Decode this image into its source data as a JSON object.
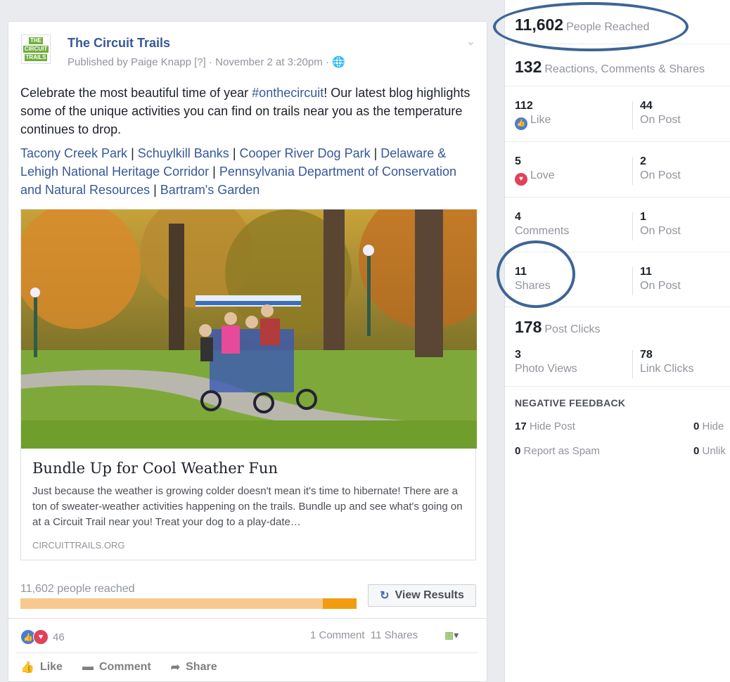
{
  "post": {
    "logo_lines": [
      "THE",
      "CIRCUIT",
      "TRAILS"
    ],
    "page_name": "The Circuit Trails",
    "byline": "Published by Paige Knapp [?] · November 2 at 3:20pm · ",
    "text_before": "Celebrate the most beautiful time of year ",
    "hashtag": "#onthecircuit",
    "text_after": "! Our latest blog highlights some of the unique activities you can find on trails near you as the temperature continues to drop.",
    "tags": [
      "Tacony Creek Park",
      "Schuylkill Banks",
      "Cooper River Dog Park",
      "Delaware & Lehigh National Heritage Corridor",
      "Pennsylvania Department of Conservation and Natural Resources",
      "Bartram's Garden"
    ],
    "link_card": {
      "title": "Bundle Up for Cool Weather Fun",
      "description": "Just because the weather is growing colder doesn't mean it's time to hibernate! There are a ton of sweater-weather activities happening on the trails. Bundle up and see what's going on at a Circuit Trail near you! Treat your dog to a play-date…",
      "domain": "CIRCUITTRAILS.ORG"
    },
    "reach_label": "11,602 people reached",
    "reach_paid_fraction": 0.1,
    "view_results_label": "View Results",
    "reaction_count": "46",
    "comments_label": "1 Comment",
    "shares_label": "11 Shares",
    "actions": {
      "like": "Like",
      "comment": "Comment",
      "share": "Share"
    }
  },
  "insights": {
    "people_reached": {
      "value": "11,602",
      "label": "People Reached"
    },
    "engagement": {
      "value": "132",
      "label": "Reactions, Comments & Shares"
    },
    "likes": {
      "value": "112",
      "label": "Like",
      "on_post": "44",
      "on_post_label": "On Post"
    },
    "love": {
      "value": "5",
      "label": "Love",
      "on_post": "2",
      "on_post_label": "On Post"
    },
    "comments": {
      "value": "4",
      "label": "Comments",
      "on_post": "1",
      "on_post_label": "On Post"
    },
    "shares": {
      "value": "11",
      "label": "Shares",
      "on_post": "11",
      "on_post_label": "On Post"
    },
    "post_clicks": {
      "value": "178",
      "label": "Post Clicks"
    },
    "photo_views": {
      "value": "3",
      "label": "Photo Views"
    },
    "link_clicks": {
      "value": "78",
      "label": "Link Clicks"
    },
    "negative_feedback": {
      "heading": "NEGATIVE FEEDBACK",
      "hide_post": {
        "value": "17",
        "label": "Hide Post"
      },
      "hide_all": {
        "value": "0",
        "label": "Hide"
      },
      "report_spam": {
        "value": "0",
        "label": "Report as Spam"
      },
      "unlike": {
        "value": "0",
        "label": "Unlik"
      }
    }
  },
  "colors": {
    "link": "#365899",
    "highlight_ellipse": "#3d6596",
    "reach_bar": "#f7c98f",
    "reach_bar_paid": "#f29c12"
  }
}
